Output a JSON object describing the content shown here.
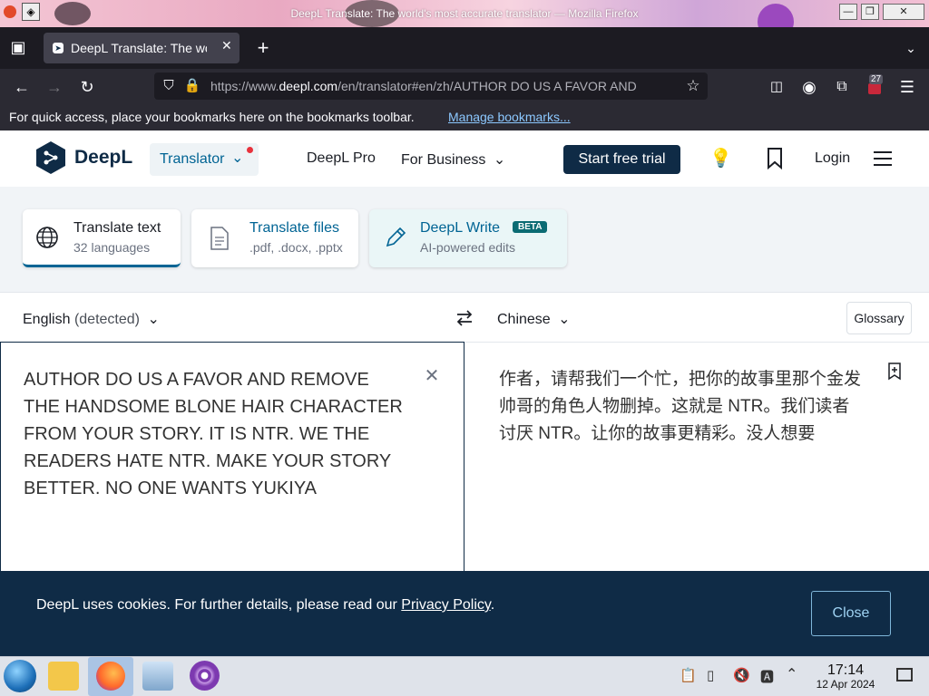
{
  "window": {
    "title": "DeepL Translate: The world's most accurate translator — Mozilla Firefox"
  },
  "browser": {
    "tab_title": "DeepL Translate: The wo",
    "url_prefix": "https://www.",
    "url_domain": "deepl.com",
    "url_path": "/en/translator#en/zh/AUTHOR DO US A FAVOR AND",
    "extension_badge": "27",
    "bookmarks_msg": "For quick access, place your bookmarks here on the bookmarks toolbar.",
    "bookmarks_link": "Manage bookmarks..."
  },
  "deepl": {
    "logo_text": "DeepL",
    "nav": {
      "translator": "Translator",
      "pro": "DeepL Pro",
      "business": "For Business",
      "trial": "Start free trial",
      "login": "Login"
    },
    "cards": [
      {
        "title": "Translate text",
        "sub": "32 languages"
      },
      {
        "title": "Translate files",
        "sub": ".pdf, .docx, .pptx"
      },
      {
        "title": "DeepL Write",
        "badge": "BETA",
        "sub": "AI-powered edits"
      }
    ],
    "source_lang": "English",
    "source_detected": "(detected)",
    "target_lang": "Chinese",
    "glossary": "Glossary",
    "source_text": "AUTHOR DO US A FAVOR AND REMOVE THE HANDSOME BLONE HAIR CHARACTER FROM YOUR STORY. IT IS NTR. WE THE READERS HATE NTR. MAKE YOUR STORY BETTER. NO ONE WANTS YUKIYA",
    "target_text": "作者，请帮我们一个忙，把你的故事里那个金发帅哥的角色人物删掉。这就是 NTR。我们读者讨厌 NTR。让你的故事更精彩。没人想要",
    "cookie": {
      "text": "DeepL uses cookies. For further details, please read our ",
      "link": "Privacy Policy",
      "tail": ".",
      "close": "Close"
    }
  },
  "taskbar": {
    "time": "17:14",
    "date": "12 Apr 2024"
  },
  "colors": {
    "deepl_navy": "#0f2b46",
    "accent_teal": "#006494",
    "link_blue": "#0060df"
  }
}
